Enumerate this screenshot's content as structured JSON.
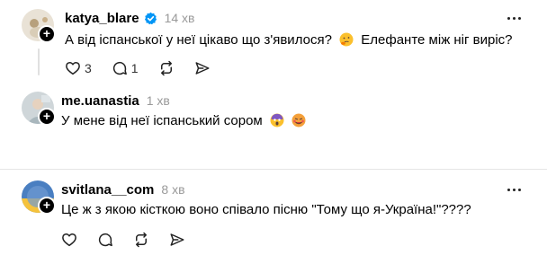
{
  "posts": [
    {
      "username": "katya_blare",
      "time": "14 хв",
      "text": "А від іспанської у неї цікаво що з'явилося?",
      "text2": "Елефанте між ніг виріс?",
      "likes": "3",
      "comments": "1"
    },
    {
      "username": "me.uanastia",
      "time": "1 хв",
      "text": "У мене від неї іспанський сором"
    },
    {
      "username": "svitlana__com",
      "time": "8 хв",
      "text": "Це ж з якою кісткою воно співало пісню \"Тому що я-Україна!\"????"
    }
  ],
  "icons": {
    "like": "heart-icon",
    "comment": "comment-icon",
    "repost": "repost-icon",
    "share": "share-icon",
    "more": "more-icon",
    "verified": "verified-badge-icon"
  },
  "colors": {
    "verified": "#0095f6",
    "muted": "#999999",
    "divider": "#e5e5e5"
  }
}
